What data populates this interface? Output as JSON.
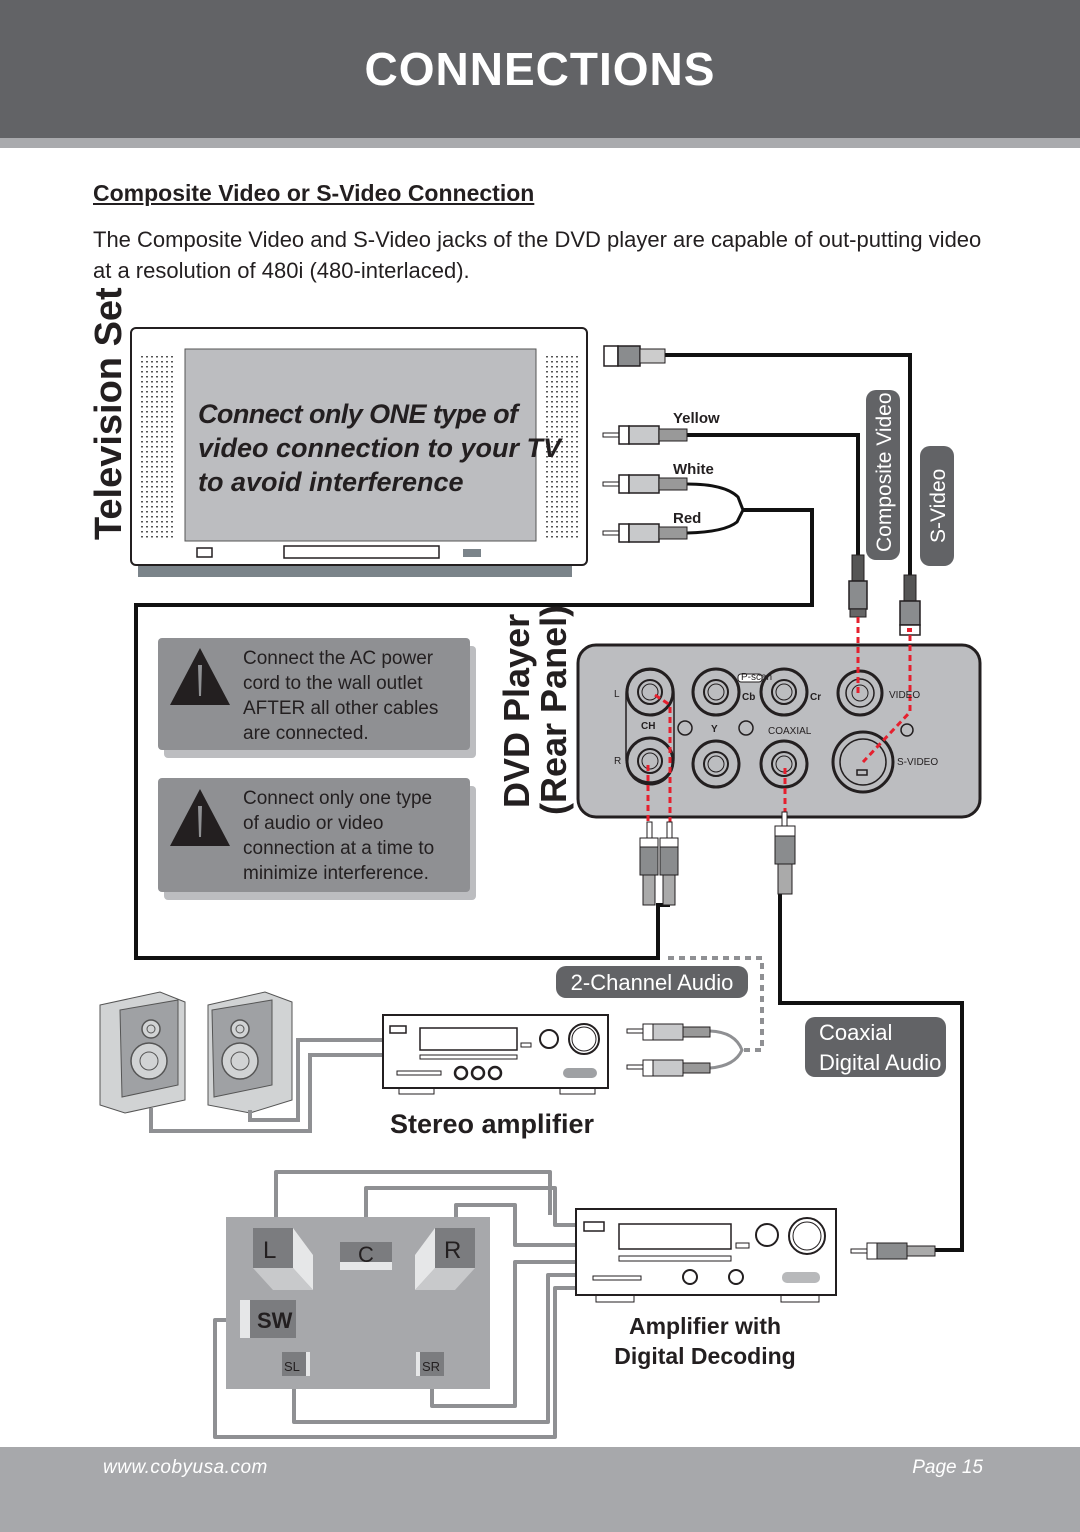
{
  "header": {
    "title": "CONNECTIONS"
  },
  "section": {
    "title": "Composite Video or S-Video Connection",
    "body": "The Composite Video and S-Video jacks of the DVD player are capable of out-putting video at a resolution of 480i (480-interlaced)."
  },
  "tv": {
    "label": "Television Set",
    "screen_lines": [
      "Connect  only  ONE  type  of",
      "video connection to your TV",
      "to avoid interference"
    ]
  },
  "cables": {
    "yellow": "Yellow",
    "white": "White",
    "red": "Red",
    "composite_video": "Composite Video",
    "s_video": "S-Video"
  },
  "warnings": [
    {
      "icon": "warning-triangle-icon",
      "lines": [
        "Connect the AC power",
        "cord to the wall outlet",
        "AFTER all other cables",
        "are connected."
      ]
    },
    {
      "icon": "warning-triangle-icon",
      "lines": [
        "Connect only one type",
        "of audio or video",
        "connection at a time to",
        "minimize interference."
      ]
    }
  ],
  "dvd": {
    "label_line1": "DVD Player",
    "label_line2": "(Rear Panel)",
    "jacks": {
      "l": "L",
      "r": "R",
      "ch": "CH",
      "y": "Y",
      "cb": "Cb",
      "cr": "Cr",
      "pscan": "P-scan",
      "coaxial": "COAXIAL",
      "video": "VIDEO",
      "svideo": "S-VIDEO"
    }
  },
  "audio": {
    "two_channel": "2-Channel Audio",
    "coaxial_line1": "Coaxial",
    "coaxial_line2": "Digital Audio",
    "stereo_amp": "Stereo amplifier",
    "decoder_line1": "Amplifier with",
    "decoder_line2": "Digital Decoding"
  },
  "surround": {
    "l": "L",
    "c": "C",
    "r": "R",
    "sw": "SW",
    "sl": "SL",
    "sr": "SR"
  },
  "colors": {
    "header_bg": "#626366",
    "footer_bg": "#a7a8ab",
    "pill_bg": "#626366",
    "signal_red": "#e5202e"
  },
  "footer": {
    "url": "www.cobyusa.com",
    "page": "Page 15"
  }
}
